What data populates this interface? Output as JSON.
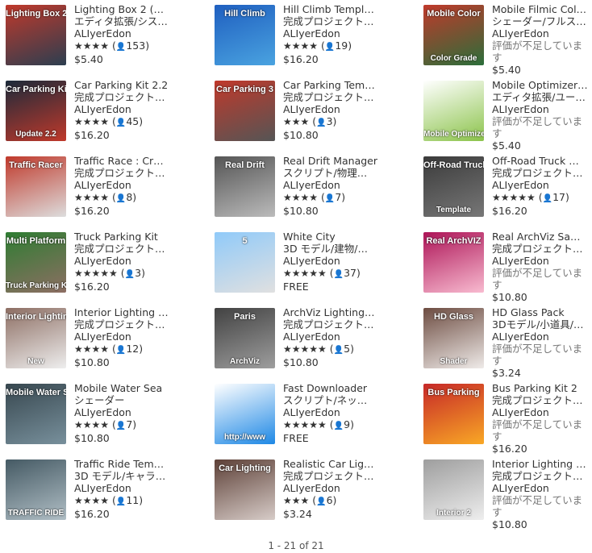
{
  "items": [
    {
      "title": "Lighting Box 2 (…",
      "category": "エディタ拡張/シス…",
      "publisher": "ALIyerEdon",
      "stars": "★★★★",
      "count": "153",
      "price": "$5.40",
      "thumb": {
        "banner": "Lighting Box 2",
        "foot": "",
        "colors": [
          "#c0392b",
          "#2c3e50"
        ]
      }
    },
    {
      "title": "Hill Climb Templ…",
      "category": "完成プロジェクト…",
      "publisher": "ALIyerEdon",
      "stars": "★★★★",
      "count": "19",
      "price": "$16.20",
      "thumb": {
        "banner": "Hill Climb",
        "foot": "",
        "colors": [
          "#1f5fc0",
          "#4aa3e0"
        ]
      }
    },
    {
      "title": "Mobile Filmic Col…",
      "category": "シェーダー/フルス…",
      "publisher": "ALIyerEdon",
      "not_rated": "評価が不足しています",
      "price": "$5.40",
      "thumb": {
        "banner": "Mobile Color",
        "foot": "Color Grade",
        "colors": [
          "#c0392b",
          "#2b6e3a"
        ]
      }
    },
    {
      "title": "Car Parking Kit 2.2",
      "category": "完成プロジェクト…",
      "publisher": "ALIyerEdon",
      "stars": "★★★★",
      "count": "45",
      "price": "$16.20",
      "thumb": {
        "banner": "Car Parking Kit",
        "foot": "Update 2.2",
        "colors": [
          "#1c2a3a",
          "#c0392b"
        ]
      }
    },
    {
      "title": "Car Parking Tem…",
      "category": "完成プロジェクト…",
      "publisher": "ALIyerEdon",
      "stars": "★★★",
      "count": "3",
      "price": "$10.80",
      "thumb": {
        "banner": "Car Parking 3",
        "foot": "",
        "colors": [
          "#c0392b",
          "#555555"
        ]
      }
    },
    {
      "title": "Mobile Optimizer…",
      "category": "エディタ拡張/ユー…",
      "publisher": "ALIyerEdon",
      "not_rated": "評価が不足しています",
      "price": "$5.40",
      "thumb": {
        "banner": "",
        "foot": "Mobile Optimizer",
        "colors": [
          "#ffffff",
          "#8bc34a"
        ]
      }
    },
    {
      "title": "Traffic Race : Cr…",
      "category": "完成プロジェクト…",
      "publisher": "ALIyerEdon",
      "stars": "★★★★",
      "count": "8",
      "price": "$16.20",
      "thumb": {
        "banner": "Traffic Racer",
        "foot": "",
        "colors": [
          "#c0392b",
          "#dddddd"
        ]
      }
    },
    {
      "title": "Real Drift Manager",
      "category": "スクリプト/物理…",
      "publisher": "ALIyerEdon",
      "stars": "★★★★",
      "count": "7",
      "price": "$10.80",
      "thumb": {
        "banner": "Real Drift",
        "foot": "",
        "colors": [
          "#555555",
          "#bbbbbb"
        ]
      }
    },
    {
      "title": "Off-Road Truck …",
      "category": "完成プロジェクト…",
      "publisher": "ALIyerEdon",
      "stars": "★★★★★",
      "count": "17",
      "price": "$16.20",
      "thumb": {
        "banner": "Off-Road Truck",
        "foot": "Template",
        "colors": [
          "#3b3b3b",
          "#777777"
        ]
      }
    },
    {
      "title": "Truck Parking Kit",
      "category": "完成プロジェクト…",
      "publisher": "ALIyerEdon",
      "stars": "★★★★★",
      "count": "3",
      "price": "$16.20",
      "thumb": {
        "banner": "Multi Platform",
        "foot": "Truck Parking Kit",
        "colors": [
          "#2e7d32",
          "#8d6e63"
        ]
      }
    },
    {
      "title": "White City",
      "category": "3D モデル/建物/…",
      "publisher": "ALIyerEdon",
      "stars": "★★★★★",
      "count": "37",
      "price": "FREE",
      "thumb": {
        "banner": "5",
        "foot": "",
        "colors": [
          "#90caf9",
          "#e0e0e0"
        ]
      }
    },
    {
      "title": "Real ArchViz Sa…",
      "category": "完成プロジェクト…",
      "publisher": "ALIyerEdon",
      "not_rated": "評価が不足しています",
      "price": "$10.80",
      "thumb": {
        "banner": "Real ArchVIZ",
        "foot": "",
        "colors": [
          "#ad1457",
          "#f8bbd0"
        ]
      }
    },
    {
      "title": "Interior Lighting …",
      "category": "完成プロジェクト…",
      "publisher": "ALIyerEdon",
      "stars": "★★★★",
      "count": "12",
      "price": "$10.80",
      "thumb": {
        "banner": "Interior Lighting",
        "foot": "New",
        "colors": [
          "#8d6e63",
          "#eeeeee"
        ]
      }
    },
    {
      "title": "ArchViz Lighting…",
      "category": "完成プロジェクト…",
      "publisher": "ALIyerEdon",
      "stars": "★★★★★",
      "count": "5",
      "price": "$10.80",
      "thumb": {
        "banner": "Paris",
        "foot": "ArchViz",
        "colors": [
          "#424242",
          "#9e9e9e"
        ]
      }
    },
    {
      "title": "HD Glass Pack",
      "category": "3Dモデル/小道具/…",
      "publisher": "ALIyerEdon",
      "not_rated": "評価が不足しています",
      "price": "$3.24",
      "thumb": {
        "banner": "HD Glass",
        "foot": "Shader",
        "colors": [
          "#6d4c41",
          "#efebe9"
        ]
      }
    },
    {
      "title": "Mobile Water Sea",
      "category": "シェーダー",
      "publisher": "ALIyerEdon",
      "stars": "★★★★",
      "count": "7",
      "price": "$10.80",
      "thumb": {
        "banner": "Mobile Water Sea",
        "foot": "",
        "colors": [
          "#37474f",
          "#78909c"
        ]
      }
    },
    {
      "title": "Fast Downloader",
      "category": "スクリプト/ネッ…",
      "publisher": "ALIyerEdon",
      "stars": "★★★★★",
      "count": "9",
      "price": "FREE",
      "thumb": {
        "banner": "",
        "foot": "http://www",
        "colors": [
          "#ffffff",
          "#1e88e5"
        ]
      }
    },
    {
      "title": "Bus Parking Kit 2",
      "category": "完成プロジェクト…",
      "publisher": "ALIyerEdon",
      "not_rated": "評価が不足しています",
      "price": "$16.20",
      "thumb": {
        "banner": "Bus Parking",
        "foot": "",
        "colors": [
          "#c62828",
          "#f9a825"
        ]
      }
    },
    {
      "title": "Traffic Ride Tem…",
      "category": "3D モデル/キャラ…",
      "publisher": "ALIyerEdon",
      "stars": "★★★★",
      "count": "11",
      "price": "$16.20",
      "thumb": {
        "banner": "",
        "foot": "TRAFFIC RIDE",
        "colors": [
          "#455a64",
          "#b0bec5"
        ]
      }
    },
    {
      "title": "Realistic Car Lig…",
      "category": "完成プロジェクト…",
      "publisher": "ALIyerEdon",
      "stars": "★★★",
      "count": "6",
      "price": "$3.24",
      "thumb": {
        "banner": "Car Lighting",
        "foot": "",
        "colors": [
          "#5d4037",
          "#d7ccc8"
        ]
      }
    },
    {
      "title": "Interior Lighting …",
      "category": "完成プロジェクト…",
      "publisher": "ALIyerEdon",
      "not_rated": "評価が不足しています",
      "price": "$10.80",
      "thumb": {
        "banner": "",
        "foot": "Interior 2",
        "colors": [
          "#9e9e9e",
          "#eeeeee"
        ]
      }
    }
  ],
  "pager": "1 - 21 of 21",
  "user_icon": "user-icon"
}
